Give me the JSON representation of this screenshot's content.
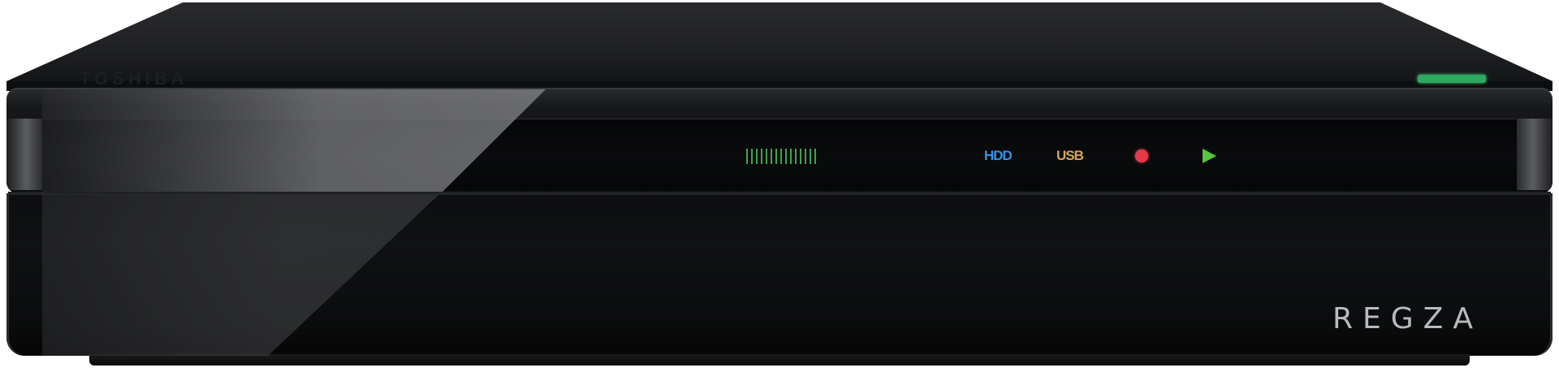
{
  "device": {
    "top_brand": "TOSHIBA",
    "front_brand": "REGZA",
    "indicators": {
      "hdd_label": "HDD",
      "usb_label": "USB",
      "record_icon": "record-dot-icon",
      "play_icon": "play-triangle-icon",
      "power_led_icon": "power-led-icon"
    },
    "colors": {
      "body": "#0d0e0f",
      "hdd": "#3a8fe0",
      "usb": "#d7a65a",
      "record": "#e5394a",
      "play": "#55c63e",
      "level_meter": "#3fa34a",
      "power_led": "#2fa860",
      "brand_text": "#b9babc"
    }
  }
}
